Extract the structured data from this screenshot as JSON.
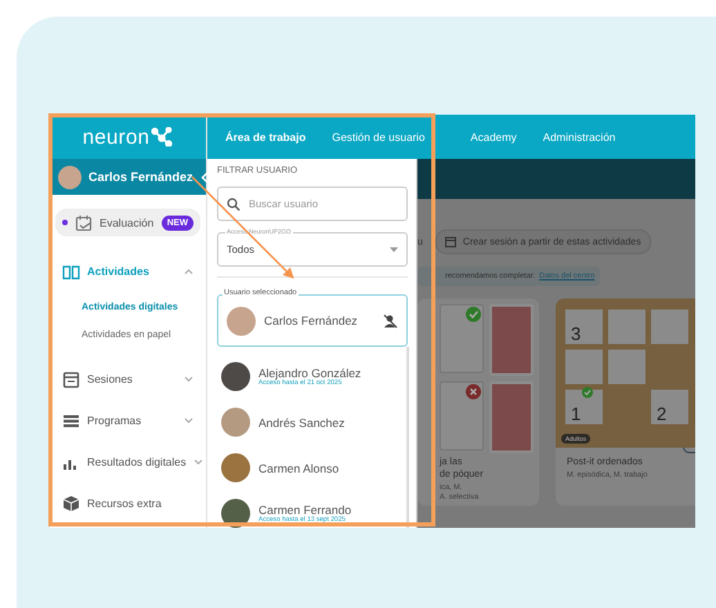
{
  "logo": {
    "text": "neuron"
  },
  "user": {
    "name": "Carlos Fernández"
  },
  "sidebar": {
    "items": [
      {
        "kind": "pill",
        "label": "Evaluación",
        "badge": "NEW",
        "selected": false
      },
      {
        "kind": "group",
        "label": "Actividades",
        "expanded": true,
        "selected": true,
        "children": [
          {
            "label": "Actividades digitales",
            "selected": true
          },
          {
            "label": "Actividades en papel",
            "selected": false
          }
        ]
      },
      {
        "kind": "group",
        "label": "Sesiones",
        "expanded": false,
        "selected": false
      },
      {
        "kind": "group",
        "label": "Programas",
        "expanded": false,
        "selected": false
      },
      {
        "kind": "group",
        "label": "Resultados digitales",
        "expanded": false,
        "selected": false
      },
      {
        "kind": "link",
        "label": "Recursos extra",
        "selected": false
      }
    ]
  },
  "top_nav": {
    "tabs": [
      {
        "label": "Área de trabajo",
        "selected": true
      },
      {
        "label": "Gestión de usuario",
        "selected": false
      },
      {
        "label": "Academy",
        "selected": false
      },
      {
        "label": "Administración",
        "selected": false
      }
    ]
  },
  "user_filter": {
    "heading": "FILTRAR USUARIO",
    "search": {
      "placeholder": "Buscar usuario"
    },
    "access_select": {
      "label": "Acceso NeuronUP2GO",
      "value": "Todos"
    },
    "selected_user": {
      "legend": "Usuario seleccionado",
      "name": "Carlos Fernández"
    },
    "users": [
      {
        "name": "Alejandro González",
        "access": "Acceso hasta el 21 oct 2025"
      },
      {
        "name": "Andrés Sanchez"
      },
      {
        "name": "Carmen Alonso"
      },
      {
        "name": "Carmen Ferrando",
        "access": "Acceso hasta el 13 sept 2025"
      }
    ]
  },
  "content": {
    "cut_text": "u",
    "create_button": "Crear sesión a partir de estas actividades",
    "notice": {
      "text": "recomendamos completar:",
      "link": "Datos del centro"
    },
    "cards": [
      {
        "kind": "poker",
        "title": "ja las\nde póquer",
        "tags": "ica, M.\nA. selectiva"
      },
      {
        "kind": "board",
        "numbers": [
          "3",
          "1",
          "2"
        ],
        "badge": "Adultos",
        "title": "Post-it ordenados",
        "tags": "M. episódica, M. trabajo"
      }
    ]
  }
}
